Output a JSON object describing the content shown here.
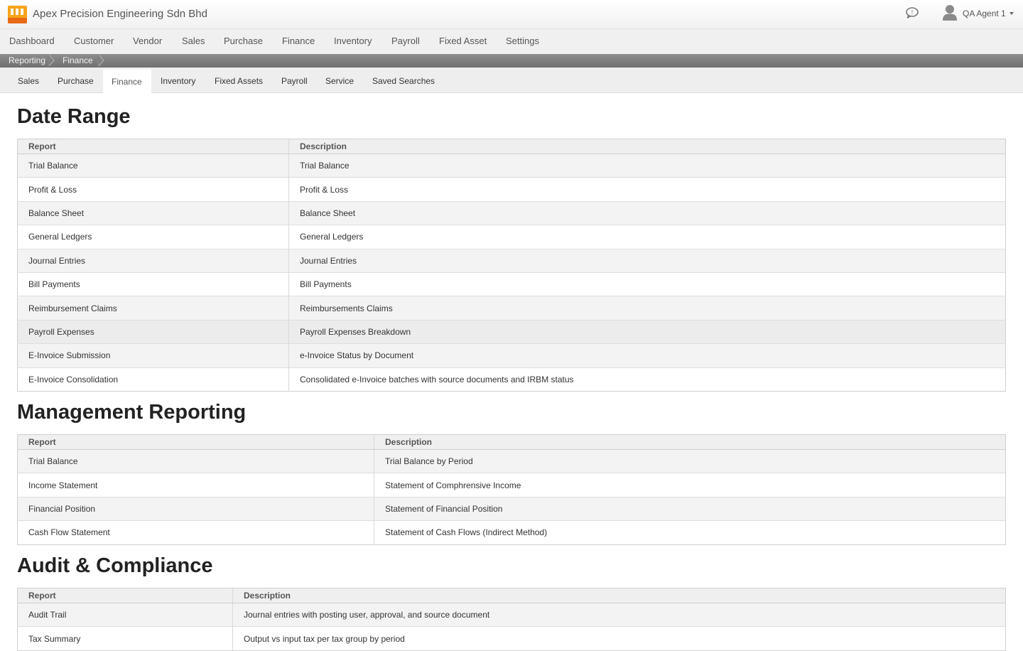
{
  "header": {
    "company_name": "Apex Precision Engineering Sdn Bhd",
    "user_name": "QA Agent 1",
    "icons": [
      "logo-icon",
      "chat-icon",
      "user-icon",
      "caret-down-icon"
    ]
  },
  "main_nav": {
    "items": [
      {
        "label": "Dashboard"
      },
      {
        "label": "Customer"
      },
      {
        "label": "Vendor"
      },
      {
        "label": "Sales"
      },
      {
        "label": "Purchase"
      },
      {
        "label": "Finance"
      },
      {
        "label": "Inventory"
      },
      {
        "label": "Payroll"
      },
      {
        "label": "Fixed Asset"
      },
      {
        "label": "Settings"
      }
    ]
  },
  "breadcrumb": {
    "items": [
      {
        "label": "Reporting"
      },
      {
        "label": "Finance"
      }
    ]
  },
  "sub_tabs": {
    "active": "Finance",
    "items": [
      {
        "label": "Sales"
      },
      {
        "label": "Purchase"
      },
      {
        "label": "Finance"
      },
      {
        "label": "Inventory"
      },
      {
        "label": "Fixed Assets"
      },
      {
        "label": "Payroll"
      },
      {
        "label": "Service"
      },
      {
        "label": "Saved Searches"
      }
    ]
  },
  "sections": [
    {
      "title": "Date Range",
      "columns": [
        "Report",
        "Description"
      ],
      "rows": [
        {
          "report": "Trial Balance",
          "description": "Trial Balance"
        },
        {
          "report": "Profit & Loss",
          "description": "Profit & Loss"
        },
        {
          "report": "Balance Sheet",
          "description": "Balance Sheet"
        },
        {
          "report": "General Ledgers",
          "description": "General Ledgers"
        },
        {
          "report": "Journal Entries",
          "description": "Journal Entries"
        },
        {
          "report": "Bill Payments",
          "description": "Bill Payments"
        },
        {
          "report": "Reimbursement Claims",
          "description": "Reimbursements Claims"
        },
        {
          "report": "Payroll Expenses",
          "description": "Payroll Expenses Breakdown"
        },
        {
          "report": "E-Invoice Submission",
          "description": "e-Invoice Status by Document"
        },
        {
          "report": "E-Invoice Consolidation",
          "description": "Consolidated e-Invoice batches with source documents and IRBM status"
        }
      ]
    },
    {
      "title": "Management Reporting",
      "columns": [
        "Report",
        "Description"
      ],
      "rows": [
        {
          "report": "Trial Balance",
          "description": "Trial Balance by Period"
        },
        {
          "report": "Income Statement",
          "description": "Statement of Comphrensive Income"
        },
        {
          "report": "Financial Position",
          "description": "Statement of Financial Position"
        },
        {
          "report": "Cash Flow Statement",
          "description": "Statement of Cash Flows (Indirect Method)"
        }
      ]
    },
    {
      "title": "Audit & Compliance",
      "columns": [
        "Report",
        "Description"
      ],
      "rows": [
        {
          "report": "Audit Trail",
          "description": "Journal entries with posting user, approval, and source document"
        },
        {
          "report": "Tax Summary",
          "description": "Output vs input tax per tax group by period"
        }
      ]
    }
  ]
}
